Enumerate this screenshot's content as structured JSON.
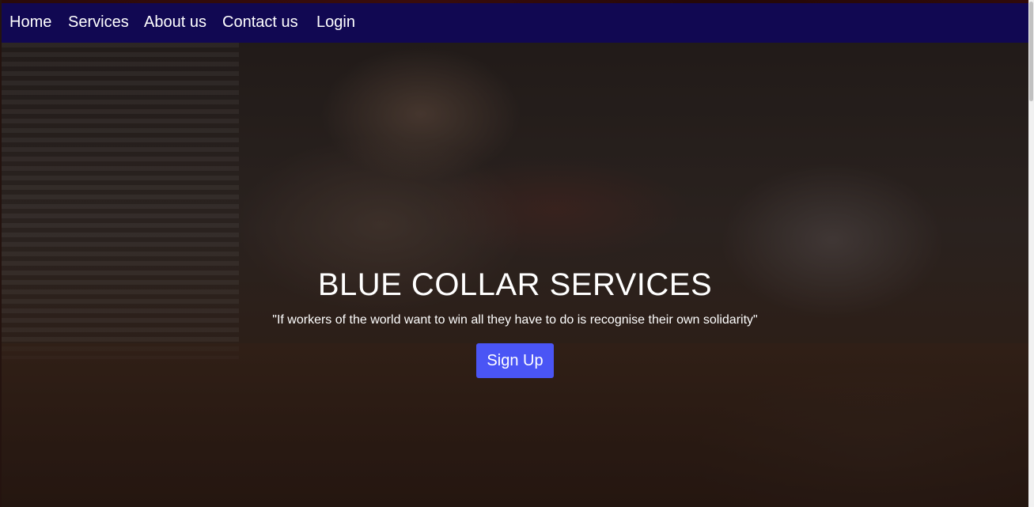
{
  "nav": {
    "items": [
      {
        "label": "Home"
      },
      {
        "label": "Services"
      },
      {
        "label": "About us"
      },
      {
        "label": "Contact us"
      },
      {
        "label": "Login"
      }
    ]
  },
  "hero": {
    "title": "BLUE COLLAR SERVICES",
    "quote": "\"If workers of the world want to win all they have to do is recognise their own solidarity\"",
    "signup_label": "Sign Up",
    "background_image": "plumber-with-wrench"
  },
  "colors": {
    "navbar": "#110852",
    "button": "#4a55f5",
    "text": "#ffffff"
  }
}
